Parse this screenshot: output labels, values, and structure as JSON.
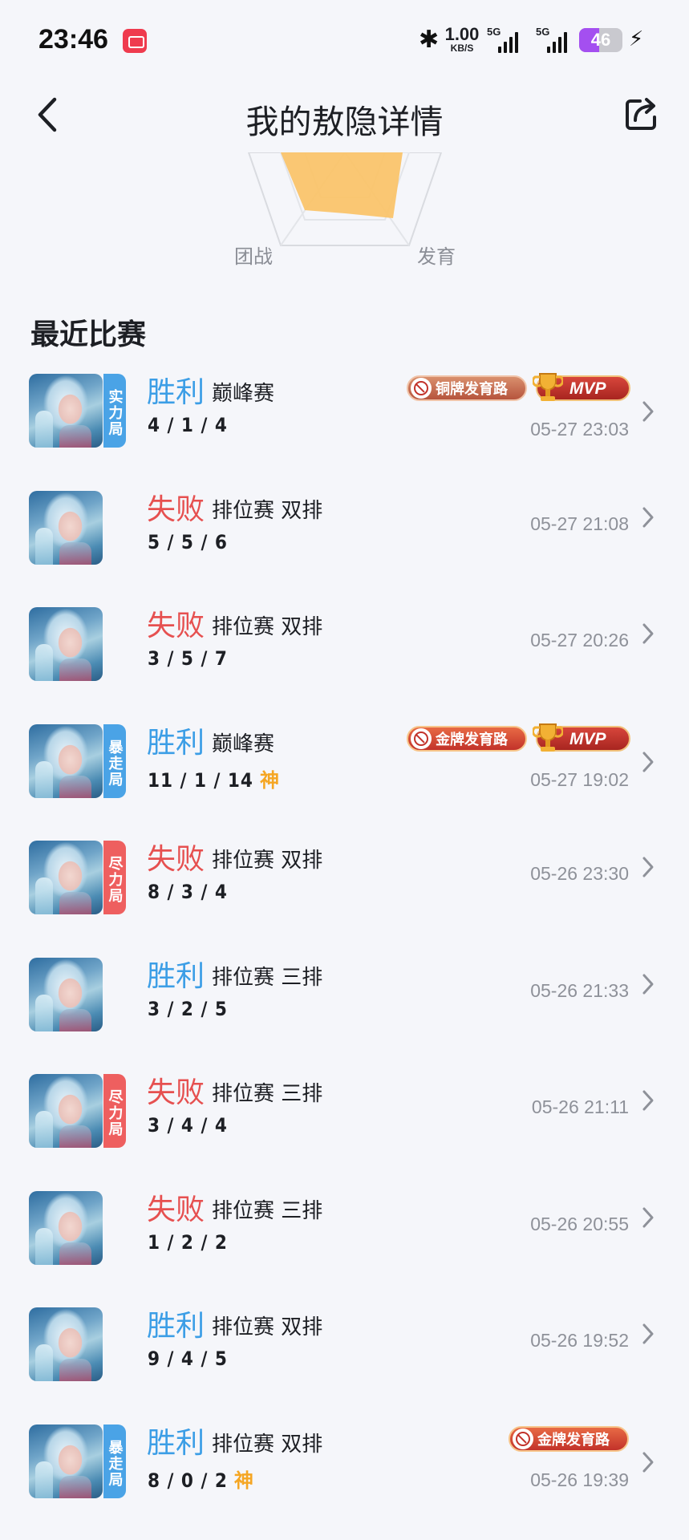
{
  "status_bar": {
    "time": "23:46",
    "net_speed_value": "1.00",
    "net_speed_unit": "KB/S",
    "signal1_label": "5G",
    "signal2_label": "5G",
    "battery_level": "46",
    "battery_color": "#a44ff0"
  },
  "header": {
    "title": "我的敖隐详情",
    "back_icon": "chevron-left-icon",
    "share_icon": "share-icon"
  },
  "radar": {
    "labels": {
      "left": "团战",
      "right": "发育"
    },
    "fill_color": "#fbc264"
  },
  "section": {
    "title": "最近比赛"
  },
  "colors": {
    "win": "#3c9ee6",
    "lose": "#e65050",
    "god": "#f5a623",
    "tag_blue": "#4aa3e6",
    "tag_red": "#ee5f5f"
  },
  "matches": [
    {
      "result": "胜利",
      "type": "巅峰赛",
      "kda": "4 / 1 / 4",
      "god": "",
      "time": "05-27 23:03",
      "tag": "实力局",
      "medal": "铜牌发育路",
      "mvp": "MVP"
    },
    {
      "result": "失败",
      "type": "排位赛 双排",
      "kda": "5 / 5 / 6",
      "god": "",
      "time": "05-27 21:08",
      "tag": "",
      "medal": "",
      "mvp": ""
    },
    {
      "result": "失败",
      "type": "排位赛 双排",
      "kda": "3 / 5 / 7",
      "god": "",
      "time": "05-27 20:26",
      "tag": "",
      "medal": "",
      "mvp": ""
    },
    {
      "result": "胜利",
      "type": "巅峰赛",
      "kda": "11 / 1 / 14",
      "god": "神",
      "time": "05-27 19:02",
      "tag": "暴走局",
      "medal": "金牌发育路",
      "mvp": "MVP"
    },
    {
      "result": "失败",
      "type": "排位赛 双排",
      "kda": "8 / 3 / 4",
      "god": "",
      "time": "05-26 23:30",
      "tag": "尽力局",
      "medal": "",
      "mvp": ""
    },
    {
      "result": "胜利",
      "type": "排位赛 三排",
      "kda": "3 / 2 / 5",
      "god": "",
      "time": "05-26 21:33",
      "tag": "",
      "medal": "",
      "mvp": ""
    },
    {
      "result": "失败",
      "type": "排位赛 三排",
      "kda": "3 / 4 / 4",
      "god": "",
      "time": "05-26 21:11",
      "tag": "尽力局",
      "medal": "",
      "mvp": ""
    },
    {
      "result": "失败",
      "type": "排位赛 三排",
      "kda": "1 / 2 / 2",
      "god": "",
      "time": "05-26 20:55",
      "tag": "",
      "medal": "",
      "mvp": ""
    },
    {
      "result": "胜利",
      "type": "排位赛 双排",
      "kda": "9 / 4 / 5",
      "god": "",
      "time": "05-26 19:52",
      "tag": "",
      "medal": "",
      "mvp": ""
    },
    {
      "result": "胜利",
      "type": "排位赛 双排",
      "kda": "8 / 0 / 2",
      "god": "神",
      "time": "05-26 19:39",
      "tag": "暴走局",
      "medal": "金牌发育路",
      "mvp": ""
    }
  ]
}
